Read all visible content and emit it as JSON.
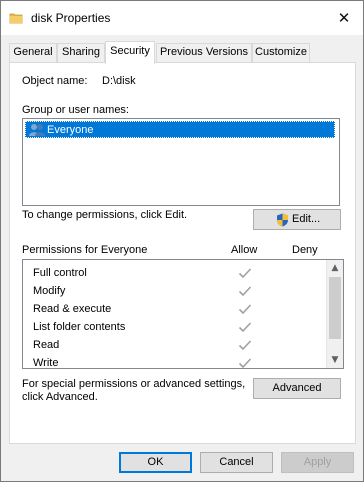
{
  "window": {
    "title": "disk Properties",
    "close_glyph": "✕"
  },
  "tabs": [
    {
      "label": "General"
    },
    {
      "label": "Sharing"
    },
    {
      "label": "Security",
      "active": true
    },
    {
      "label": "Previous Versions"
    },
    {
      "label": "Customize"
    }
  ],
  "security": {
    "object_name_label": "Object name:",
    "object_name_value": "D:\\disk",
    "group_label": "Group or user names:",
    "users": [
      {
        "name": "Everyone",
        "selected": true,
        "icon": "users-icon"
      }
    ],
    "change_hint": "To change permissions, click Edit.",
    "edit_button": "Edit...",
    "permissions_for": "Permissions for Everyone",
    "allow_header": "Allow",
    "deny_header": "Deny",
    "permissions": [
      {
        "name": "Full control",
        "allow": true,
        "deny": false
      },
      {
        "name": "Modify",
        "allow": true,
        "deny": false
      },
      {
        "name": "Read & execute",
        "allow": true,
        "deny": false
      },
      {
        "name": "List folder contents",
        "allow": true,
        "deny": false
      },
      {
        "name": "Read",
        "allow": true,
        "deny": false
      },
      {
        "name": "Write",
        "allow": true,
        "deny": false
      }
    ],
    "advanced_hint_line1": "For special permissions or advanced settings,",
    "advanced_hint_line2": "click Advanced.",
    "advanced_button": "Advanced"
  },
  "footer": {
    "ok": "OK",
    "cancel": "Cancel",
    "apply": "Apply"
  },
  "colors": {
    "accent": "#0078d7",
    "check_gray": "#a0a0a0",
    "window_bg": "#f0f0f0"
  }
}
